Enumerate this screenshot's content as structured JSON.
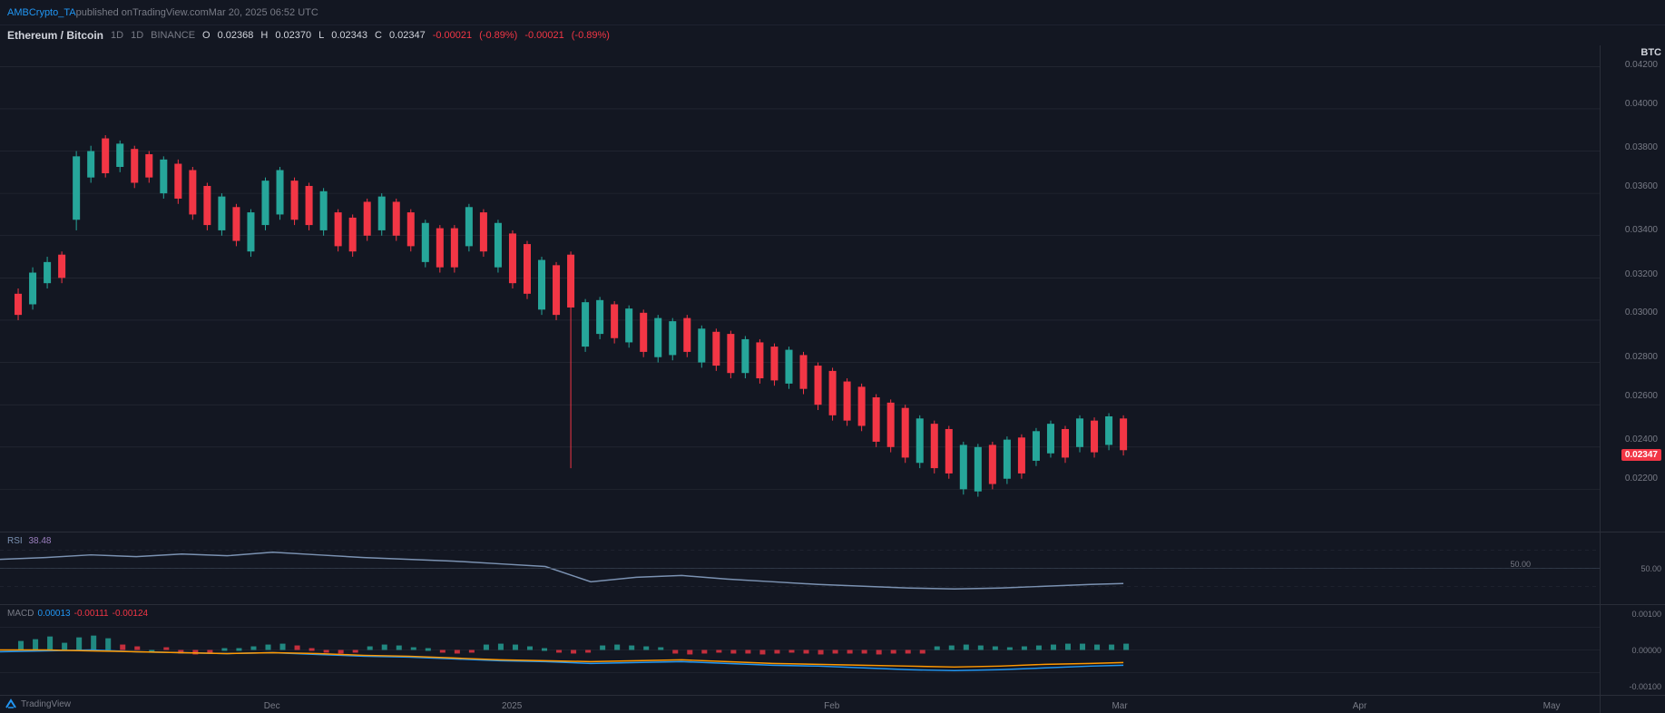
{
  "header": {
    "publisher": "AMBCrypto_TA",
    "platform": "TradingView.com",
    "date": "Mar 20, 2025 06:52 UTC",
    "published_text": "published on",
    "separator": ","
  },
  "ticker": {
    "pair": "Ethereum / Bitcoin",
    "timeframe": "1D",
    "exchange": "BINANCE",
    "open_label": "O",
    "open_value": "0.02368",
    "high_label": "H",
    "high_value": "0.02370",
    "low_label": "L",
    "low_value": "0.02343",
    "close_label": "C",
    "close_value": "0.02347",
    "change1": "-0.00021",
    "change1_pct": "(-0.89%)",
    "change2": "-0.00021",
    "change2_pct": "(-0.89%)"
  },
  "price_scale": {
    "btc_label": "BTC",
    "levels": [
      "0.04200",
      "0.04000",
      "0.03800",
      "0.03600",
      "0.03400",
      "0.03200",
      "0.03000",
      "0.02800",
      "0.02600",
      "0.02400",
      "0.02200"
    ],
    "current_price": "0.02347"
  },
  "rsi": {
    "label": "RSI",
    "value": "38.48",
    "scale_50": "50.00"
  },
  "macd": {
    "label": "MACD",
    "v1_label": "0.00013",
    "v2_label": "-0.00111",
    "v3_label": "-0.00124",
    "scale_pos": "0.00100",
    "scale_zero": "0.00000",
    "scale_neg": "-0.00100"
  },
  "time_axis": {
    "labels": [
      "Dec",
      "2025",
      "Feb",
      "Mar",
      "Apr",
      "May"
    ]
  },
  "tv_logo": {
    "text": "TradingView"
  }
}
